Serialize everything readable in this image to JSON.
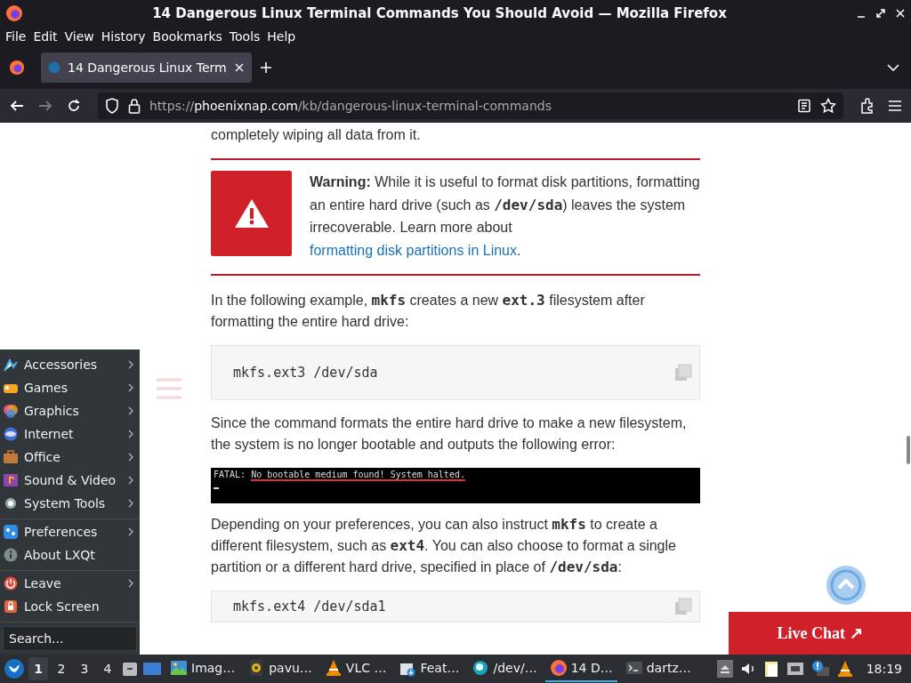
{
  "window": {
    "title": "14 Dangerous Linux Terminal Commands You Should Avoid — Mozilla Firefox"
  },
  "menubar": [
    "File",
    "Edit",
    "View",
    "History",
    "Bookmarks",
    "Tools",
    "Help"
  ],
  "tabs": [
    {
      "title": "14 Dangerous Linux Term",
      "selected": true
    }
  ],
  "url": {
    "scheme": "https://",
    "host": "phoenixnap.com",
    "path": "/kb/dangerous-linux-terminal-commands"
  },
  "article": [
    {
      "kind": "text",
      "text": "completely wiping all data from it."
    },
    {
      "kind": "warning",
      "label": "Warning:",
      "text": "While it is useful to format disk partitions, formatting an entire hard drive (such as **/dev/sda**) leaves the system irrecoverable. Learn more about",
      "link": "formatting disk partitions in Linux",
      "after": "."
    },
    {
      "kind": "text",
      "text": "In the following example, **mkfs** creates a new **ext.3** filesystem after formatting the entire hard drive:"
    },
    {
      "kind": "code",
      "text": "mkfs.ext3 /dev/sda"
    },
    {
      "kind": "text",
      "text": "Since the command formats the entire hard drive to make a new filesystem, the system is no longer bootable and outputs the following error:"
    },
    {
      "kind": "terminal",
      "prefix": "FATAL:",
      "message": "No bootable medium found! System halted."
    },
    {
      "kind": "text",
      "text": "Depending on your preferences, you can also instruct **mkfs** to create a different filesystem, such as **ext4**. You can also choose to format a single partition or a different hard drive, specified in place of **/dev/sda**:"
    },
    {
      "kind": "code",
      "text": "mkfs.ext4 /dev/sda1"
    }
  ],
  "start_menu": {
    "groups": [
      [
        {
          "label": "Accessories",
          "submenu": true
        },
        {
          "label": "Games",
          "submenu": true
        },
        {
          "label": "Graphics",
          "submenu": true
        },
        {
          "label": "Internet",
          "submenu": true
        },
        {
          "label": "Office",
          "submenu": true
        },
        {
          "label": "Sound & Video",
          "submenu": true
        },
        {
          "label": "System Tools",
          "submenu": true
        }
      ],
      [
        {
          "label": "Preferences",
          "submenu": true
        },
        {
          "label": "About LXQt",
          "submenu": false
        }
      ],
      [
        {
          "label": "Leave",
          "submenu": true
        },
        {
          "label": "Lock Screen",
          "submenu": false
        }
      ]
    ],
    "search": {
      "placeholder": "Search..."
    }
  },
  "live_chat": {
    "label": "Live Chat ↗"
  },
  "taskbar": {
    "desktops": [
      {
        "label": "1",
        "selected": true
      },
      {
        "label": "2",
        "selected": false
      },
      {
        "label": "3",
        "selected": false
      },
      {
        "label": "4",
        "selected": false
      }
    ],
    "tasks": [
      {
        "label": "Imag…",
        "selected": false
      },
      {
        "label": "pavu…",
        "selected": false
      },
      {
        "label": "VLC …",
        "selected": false
      },
      {
        "label": "Feat…",
        "selected": false
      },
      {
        "label": "/dev/…",
        "selected": false
      },
      {
        "label": "14 D…",
        "selected": true
      },
      {
        "label": "dartz…",
        "selected": false
      }
    ],
    "clock": "18:19"
  }
}
